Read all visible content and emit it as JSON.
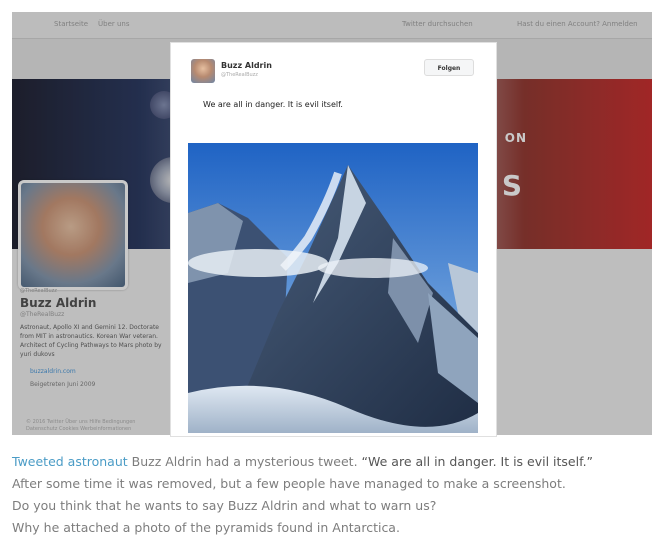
{
  "colors": {
    "link": "#4b9cc6",
    "caption_text": "#7d7d7d",
    "banner_red": "#c71e1e"
  },
  "topbar": {
    "left_items": [
      "Startseite",
      "Über uns"
    ],
    "search_placeholder": "Twitter durchsuchen",
    "right_text": "Hast du einen Account? Anmelden"
  },
  "banner": {
    "text_top": "ON",
    "text_big": "S"
  },
  "profile": {
    "mini_handle": "@TheRealBuzz",
    "name": "Buzz Aldrin",
    "handle": "@TheRealBuzz",
    "bio": "Astronaut, Apollo XI and Gemini 12. Doctorate from MIT in astronautics. Korean War veteran. Architect of Cycling Pathways to Mars photo by yuri dukovs",
    "link": "buzzaldrin.com",
    "joined": "Beigetreten Juni 2009",
    "footer_line1": "© 2016 Twitter  Über uns  Hilfe  Bedingungen",
    "footer_line2": "Datenschutz  Cookies  Werbeinformationen"
  },
  "tweet": {
    "author_name": "Buzz Aldrin",
    "author_handle": "@TheRealBuzz",
    "follow_label": "Folgen",
    "text": "We are all in danger. It is evil itself."
  },
  "caption": {
    "link_text": "Tweeted astronaut",
    "line1_rest": " Buzz Aldrin had a mysterious tweet. ",
    "line1_quote": "“We are all in danger. It is evil itself.”",
    "line2": "After some time it was removed, but a few people have managed to make a screenshot.",
    "line3": "Do you think that he wants to say Buzz Aldrin and what to warn us?",
    "line4": "Why he attached a photo of the pyramids found in Antarctica."
  }
}
